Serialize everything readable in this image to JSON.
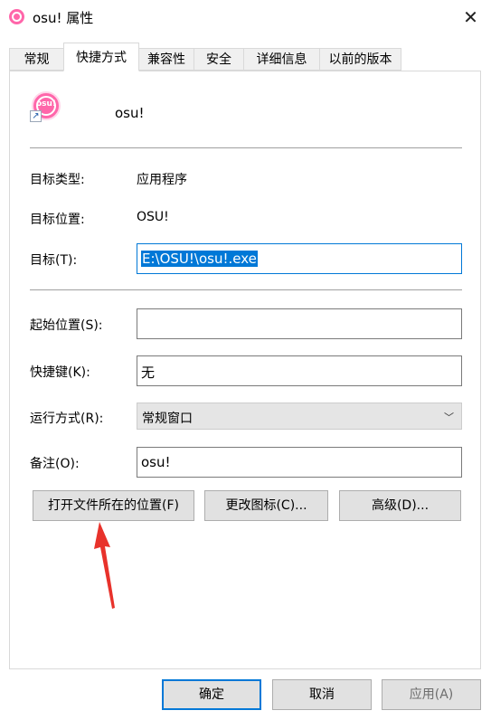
{
  "window": {
    "title": "osu! 属性",
    "close_icon": "close-icon",
    "accent": "#0078d7"
  },
  "tabs": [
    {
      "label": "常规"
    },
    {
      "label": "快捷方式"
    },
    {
      "label": "兼容性"
    },
    {
      "label": "安全"
    },
    {
      "label": "详细信息"
    },
    {
      "label": "以前的版本"
    }
  ],
  "active_tab": "快捷方式",
  "app": {
    "icon_text": "osu!",
    "name": "osu!",
    "brand_color": "#ff66aa"
  },
  "fields": {
    "target_type": {
      "label": "目标类型:",
      "value": "应用程序"
    },
    "target_location": {
      "label": "目标位置:",
      "value": "OSU!"
    },
    "target": {
      "label": "目标(T):",
      "value": "E:\\OSU!\\osu!.exe"
    },
    "start_in": {
      "label": "起始位置(S):",
      "value": ""
    },
    "shortcut_key": {
      "label": "快捷键(K):",
      "value": "无"
    },
    "run": {
      "label": "运行方式(R):",
      "value": "常规窗口"
    },
    "comment": {
      "label": "备注(O):",
      "value": "osu!"
    }
  },
  "buttons": {
    "open_location": "打开文件所在的位置(F)",
    "change_icon": "更改图标(C)...",
    "advanced": "高级(D)...",
    "ok": "确定",
    "cancel": "取消",
    "apply": "应用(A)"
  },
  "annotation": {
    "arrow_color": "#e8322b"
  }
}
